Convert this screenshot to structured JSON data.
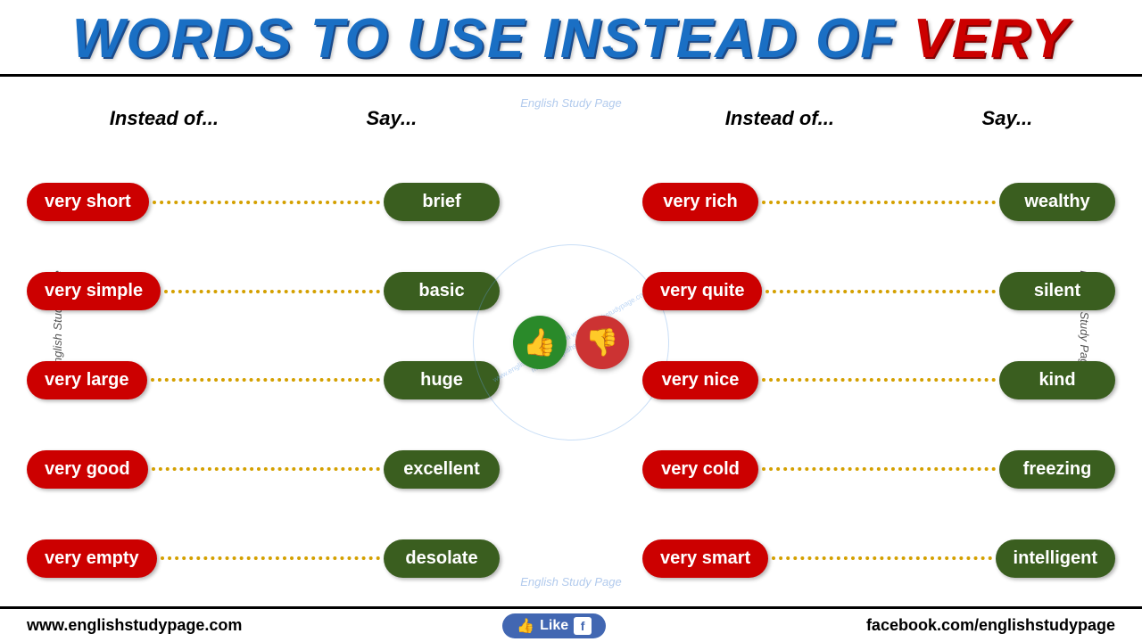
{
  "header": {
    "title_blue": "WORDS TO USE INSTEAD OF ",
    "title_red": "VERY"
  },
  "columns": {
    "instead_of": "Instead of...",
    "say": "Say..."
  },
  "left_pairs": [
    {
      "instead": "very short",
      "say": "brief"
    },
    {
      "instead": "very simple",
      "say": "basic"
    },
    {
      "instead": "very large",
      "say": "huge"
    },
    {
      "instead": "very good",
      "say": "excellent"
    },
    {
      "instead": "very empty",
      "say": "desolate"
    }
  ],
  "right_pairs": [
    {
      "instead": "very rich",
      "say": "wealthy"
    },
    {
      "instead": "very quite",
      "say": "silent"
    },
    {
      "instead": "very nice",
      "say": "kind"
    },
    {
      "instead": "very cold",
      "say": "freezing"
    },
    {
      "instead": "very smart",
      "say": "intelligent"
    }
  ],
  "watermark": {
    "text1": "English Study Page",
    "text2": "English Study Page",
    "url": "www.englishstudypage.com"
  },
  "footer": {
    "left_url": "www.englishstudypage.com",
    "like_label": "Like",
    "right_url": "facebook.com/englishstudypage"
  },
  "side_labels": {
    "left": "English Study Page",
    "right": "English Study Page"
  },
  "thumbs": {
    "up": "👍",
    "down": "👎"
  }
}
